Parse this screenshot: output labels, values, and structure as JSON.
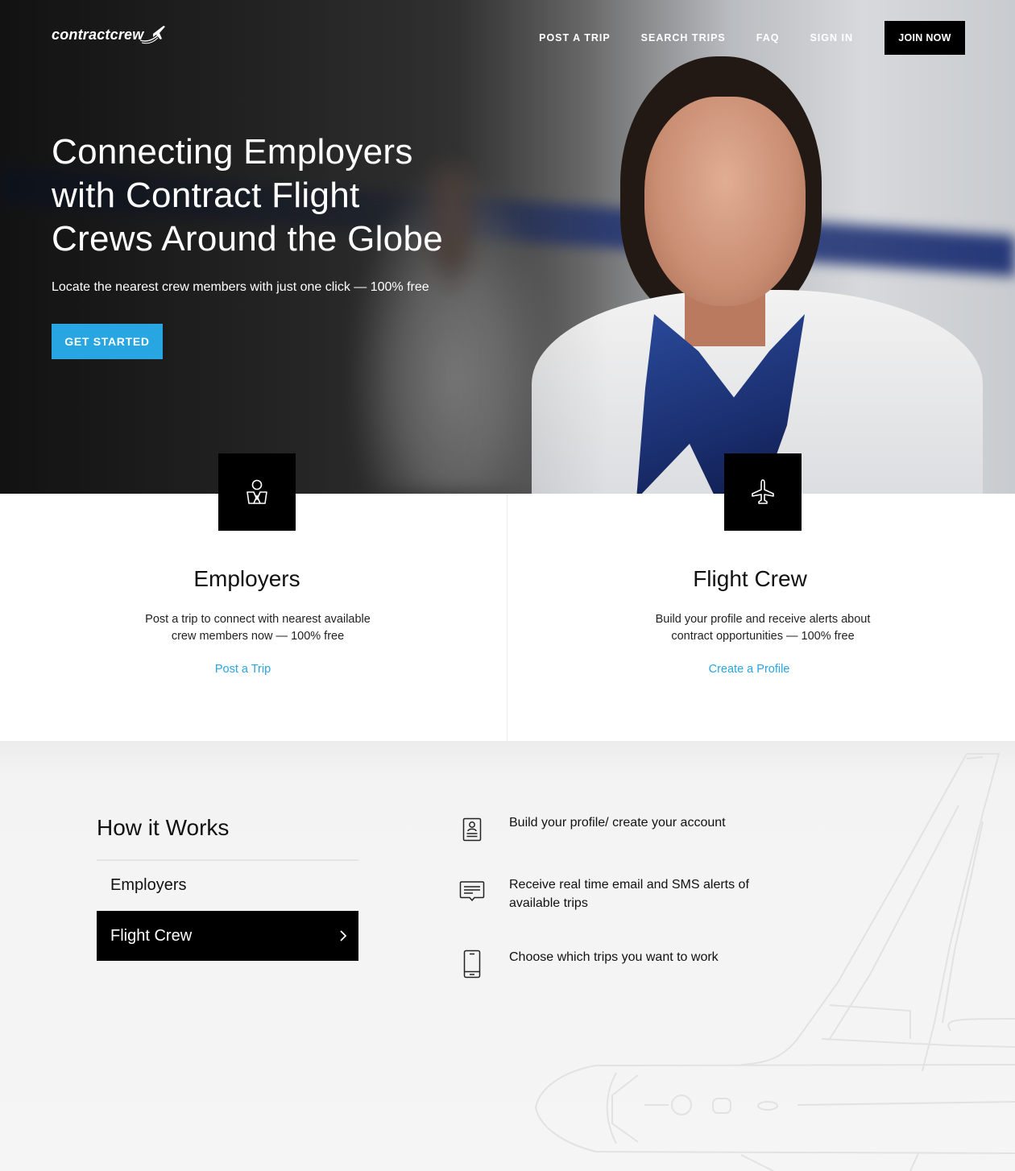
{
  "header": {
    "logo_text": "contractcrew",
    "nav": [
      {
        "label": "POST A TRIP"
      },
      {
        "label": "SEARCH TRIPS"
      },
      {
        "label": "FAQ"
      },
      {
        "label": "SIGN IN"
      }
    ],
    "join_label": "JOIN NOW"
  },
  "hero": {
    "title": "Connecting Employers with Contract Flight Crews Around the Globe",
    "subtitle": "Locate the nearest crew members with just one click — 100% free",
    "cta_label": "GET STARTED",
    "cta_color": "#27a6e2"
  },
  "cards": [
    {
      "icon": "person-icon",
      "title": "Employers",
      "description": "Post a trip to connect with nearest available crew members now — 100% free",
      "link_label": "Post a Trip"
    },
    {
      "icon": "airplane-icon",
      "title": "Flight Crew",
      "description": "Build your profile and receive alerts about contract opportunities — 100% free",
      "link_label": "Create a Profile"
    }
  ],
  "how_it_works": {
    "title": "How it Works",
    "tabs": [
      {
        "label": "Employers",
        "active": false
      },
      {
        "label": "Flight Crew",
        "active": true
      }
    ],
    "steps": [
      {
        "icon": "profile-card-icon",
        "text": "Build your profile/ create your account"
      },
      {
        "icon": "message-icon",
        "text": "Receive real time email and SMS alerts of available trips"
      },
      {
        "icon": "mobile-phone-icon",
        "text": "Choose which trips you want to work"
      }
    ]
  },
  "colors": {
    "accent": "#27a6e2",
    "dark": "#000000",
    "section_bg": "#f5f5f5"
  }
}
